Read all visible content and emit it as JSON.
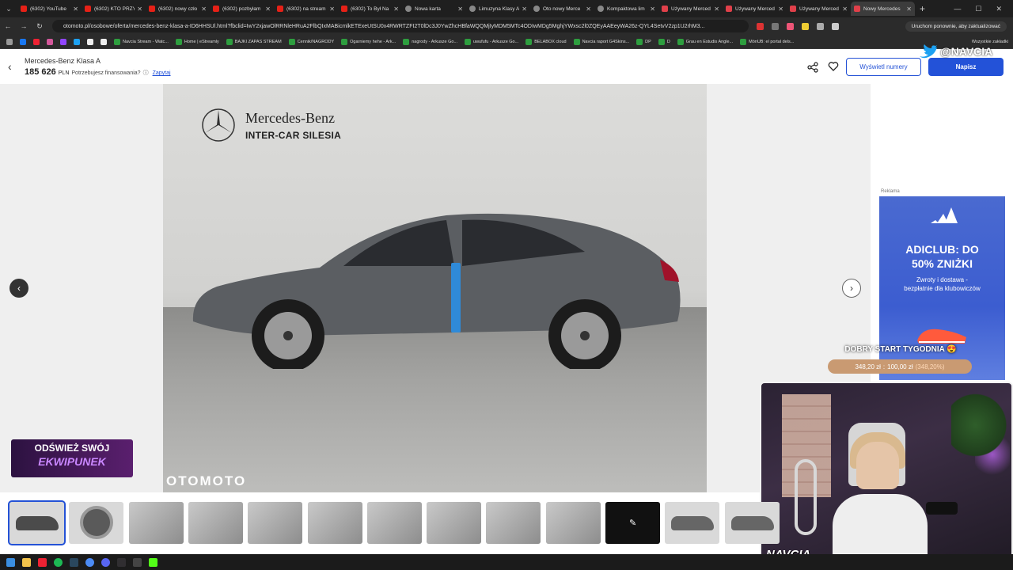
{
  "browser": {
    "tabs": [
      {
        "title": "(6302) YouTube",
        "favicon": "youtube-icon"
      },
      {
        "title": "(6302) KTO PRZY",
        "favicon": "youtube-icon"
      },
      {
        "title": "(6302) nowy czło",
        "favicon": "youtube-icon"
      },
      {
        "title": "(6302) pozbyłam",
        "favicon": "youtube-icon"
      },
      {
        "title": "(6302) na stream",
        "favicon": "youtube-icon"
      },
      {
        "title": "(6302) To Był Na",
        "favicon": "youtube-icon"
      },
      {
        "title": "Nowa karta",
        "favicon": "globe-icon"
      },
      {
        "title": "Limuzyna Klasy A",
        "favicon": "globe-icon"
      },
      {
        "title": "Oto nowy Merce",
        "favicon": "globe-icon"
      },
      {
        "title": "Kompaktowa lim",
        "favicon": "globe-icon"
      },
      {
        "title": "Używany Merced",
        "favicon": "otomoto-icon"
      },
      {
        "title": "Używany Merced",
        "favicon": "otomoto-icon"
      },
      {
        "title": "Używany Merced",
        "favicon": "otomoto-icon"
      },
      {
        "title": "Nowy Mercedes",
        "favicon": "otomoto-icon",
        "active": true
      }
    ],
    "url": "otomoto.pl/osobowe/oferta/mercedes-benz-klasa-a-ID6HHSUl.html?fbclid=IwY2xjawOlRRNleHRuA2FlbQIxMABicmlkETExeUtSU0x4RWRTZFI2T0lDc3J0YwZhcHBfaWQQMjIyMDM5MTc4ODIwMDg5MghjYWxsc2l0ZQEyAAEeyWA26z-QYL4SetvV2zp1U2rhM3...",
    "restart_label": "Uruchom ponownie, aby zaktualizować",
    "bookmarks": [
      "Navcia Stream - Watc...",
      "Home | eStreamly",
      "BAJKI ZAPAS STREAM",
      "Cennik/NAGRODY",
      "Ogarniemy hehe - Ark...",
      "nagrody - Arkusze Go...",
      "uwufufu - Arkusze Go...",
      "BELABOX cloud",
      "Navcia raport G4Skins...",
      "DP",
      "D",
      "Grau en Estudis Angle...",
      "MónUB: el portal dels..."
    ],
    "bookmarks_all": "Wszystkie zakładki"
  },
  "listing": {
    "title": "Mercedes-Benz Klasa A",
    "price": "185 626",
    "currency": "PLN",
    "financing_text": "Potrzebujesz finansowania?",
    "ask_link": "Zapytaj",
    "show_numbers_label": "Wyświetl numery",
    "write_label": "Napisz"
  },
  "photo": {
    "brand": "Mercedes-Benz",
    "dealer": "INTER-CAR SILESIA",
    "watermark": "OTOMOTO",
    "car_color": "#5b5e62",
    "tape_color": "#2f8ad8"
  },
  "thumbnails": [
    "car-side",
    "wheel",
    "interior-door",
    "seats-front",
    "seats-detail",
    "dashboard",
    "steering-wheel",
    "roof",
    "rear-seats",
    "trunk",
    "edit",
    "car-front",
    "car-rear"
  ],
  "ad": {
    "label": "Reklama",
    "title_line1": "ADICLUB: DO",
    "title_line2": "50% ZNIŻKI",
    "sub_line1": "Zwroty i dostawa -",
    "sub_line2": "bezpłatnie dla klubowiczów",
    "bg_color": "#3c5dd0"
  },
  "overlay": {
    "promo_line1": "ODŚWIEŻ SWÓJ",
    "promo_line2": "EKWIPUNEK",
    "twitter_handle": "@NAVCIA",
    "goal_title": "DOBRY START TYGODNIA 😍",
    "goal_current": "348,20 zł",
    "goal_separator": ":",
    "goal_target": "100,00 zł",
    "goal_percent": "(348,20%)",
    "cam_logo": "NAVCIA"
  }
}
